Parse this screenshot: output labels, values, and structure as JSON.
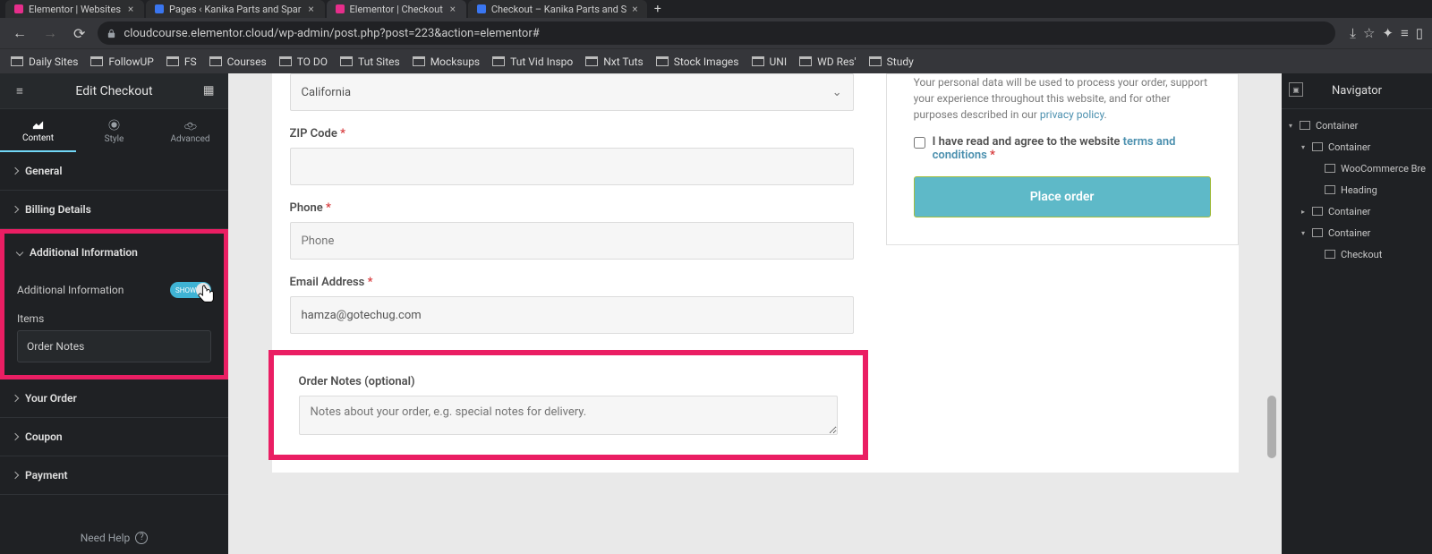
{
  "browser": {
    "tabs": [
      {
        "label": "Elementor | Websites",
        "active": false,
        "favicon": "pink"
      },
      {
        "label": "Pages ‹ Kanika Parts and Spar",
        "active": false,
        "favicon": "blue"
      },
      {
        "label": "Elementor | Checkout",
        "active": true,
        "favicon": "pink"
      },
      {
        "label": "Checkout – Kanika Parts and S",
        "active": false,
        "favicon": "blue"
      }
    ],
    "url": "cloudcourse.elementor.cloud/wp-admin/post.php?post=223&action=elementor#",
    "bookmarks": [
      "Daily Sites",
      "FollowUP",
      "FS",
      "Courses",
      "TO DO",
      "Tut Sites",
      "Mocksups",
      "Tut Vid Inspo",
      "Nxt Tuts",
      "Stock Images",
      "UNI",
      "WD Res'",
      "Study"
    ]
  },
  "panel": {
    "title": "Edit Checkout",
    "tabs": {
      "content": "Content",
      "style": "Style",
      "advanced": "Advanced"
    },
    "sections": {
      "general": "General",
      "billing": "Billing Details",
      "additional": "Additional Information",
      "yourorder": "Your Order",
      "coupon": "Coupon",
      "payment": "Payment"
    },
    "additional": {
      "toggle_label": "Additional Information",
      "toggle_state": "SHOW",
      "items_label": "Items",
      "item0": "Order Notes"
    },
    "footer": {
      "help": "Need Help"
    }
  },
  "checkout": {
    "state": {
      "value": "California"
    },
    "zip": {
      "label": "ZIP Code"
    },
    "phone": {
      "label": "Phone",
      "placeholder": "Phone"
    },
    "email": {
      "label": "Email Address",
      "value": "hamza@gotechug.com"
    },
    "ordernotes": {
      "label": "Order Notes (optional)",
      "placeholder": "Notes about your order, e.g. special notes for delivery."
    },
    "privacy": {
      "text_a": "Your personal data will be used to process your order, support your experience throughout this website, and for other purposes described in our ",
      "link": "privacy policy"
    },
    "terms": {
      "text": "I have read and agree to the website ",
      "link": "terms and conditions"
    },
    "place_order": "Place order"
  },
  "navigator": {
    "title": "Navigator",
    "tree": [
      {
        "label": "Container",
        "indent": 1,
        "caret": true
      },
      {
        "label": "Container",
        "indent": 2,
        "caret": true
      },
      {
        "label": "WooCommerce Bre",
        "indent": 3,
        "caret": false
      },
      {
        "label": "Heading",
        "indent": 3,
        "caret": false
      },
      {
        "label": "Container",
        "indent": 2,
        "caret": true
      },
      {
        "label": "Container",
        "indent": 2,
        "caret": true
      },
      {
        "label": "Checkout",
        "indent": 3,
        "caret": false
      }
    ]
  }
}
